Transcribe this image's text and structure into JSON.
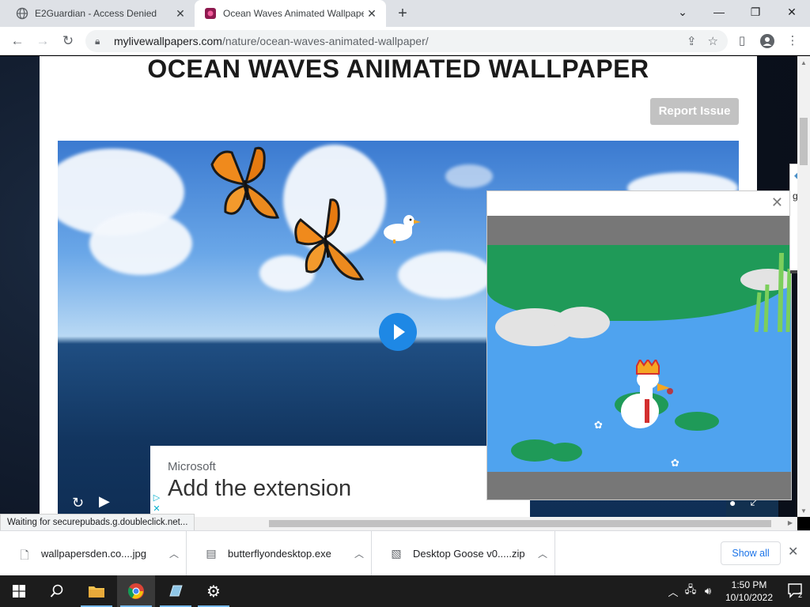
{
  "browser": {
    "tabs": [
      {
        "title": "E2Guardian - Access Denied",
        "active": false
      },
      {
        "title": "Ocean Waves Animated Wallpaper",
        "active": true
      }
    ],
    "new_tab": "+",
    "window_controls": {
      "menu": "⌄",
      "minimize": "—",
      "restore": "❐",
      "close": "✕"
    },
    "url_host": "mylivewallpapers.com",
    "url_path": "/nature/ocean-waves-animated-wallpaper/"
  },
  "page": {
    "title": "OCEAN WAVES ANIMATED WALLPAPER",
    "report_button": "Report Issue"
  },
  "ad": {
    "brand": "Microsoft",
    "headline": "Add the extension"
  },
  "side_widget": {
    "text": "goo"
  },
  "status_text": "Waiting for securepubads.g.doubleclick.net...",
  "downloads": {
    "items": [
      {
        "name": "wallpapersden.co....jpg"
      },
      {
        "name": "butterflyondesktop.exe"
      },
      {
        "name": "Desktop Goose v0.....zip"
      }
    ],
    "show_all": "Show all"
  },
  "taskbar": {
    "time": "1:50 PM",
    "date": "10/10/2022",
    "notification_count": "2"
  },
  "colors": {
    "accent": "#1a73e8",
    "play_button": "#1e88e5",
    "report_button": "#c2c2c2"
  }
}
